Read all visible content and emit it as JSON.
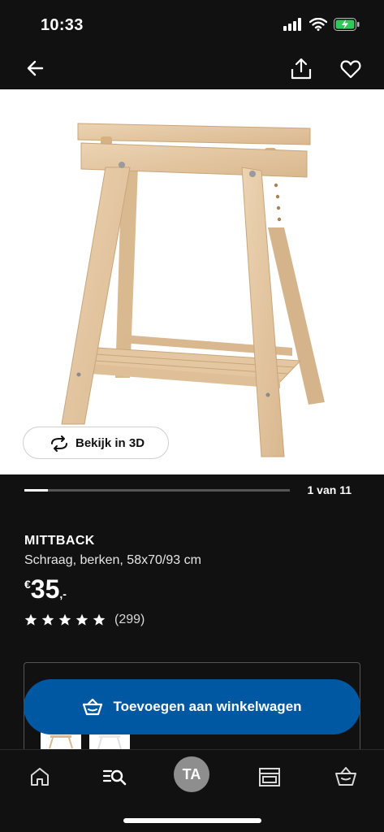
{
  "status": {
    "time": "10:33"
  },
  "view3d": {
    "label": "Bekijk in 3D"
  },
  "gallery": {
    "page": "1 van 11",
    "progress_fraction": 0.09
  },
  "product": {
    "name": "MITTBACK",
    "description": "Schraag, berken, 58x70/93 cm",
    "price_currency": "€",
    "price_value": "35",
    "price_suffix": ",-",
    "rating_count": "(299)"
  },
  "cart": {
    "button_label": "Toevoegen aan winkelwagen"
  },
  "tabs": {
    "profile_initials": "TA"
  },
  "colors": {
    "accent": "#0058a3",
    "background": "#111111"
  }
}
